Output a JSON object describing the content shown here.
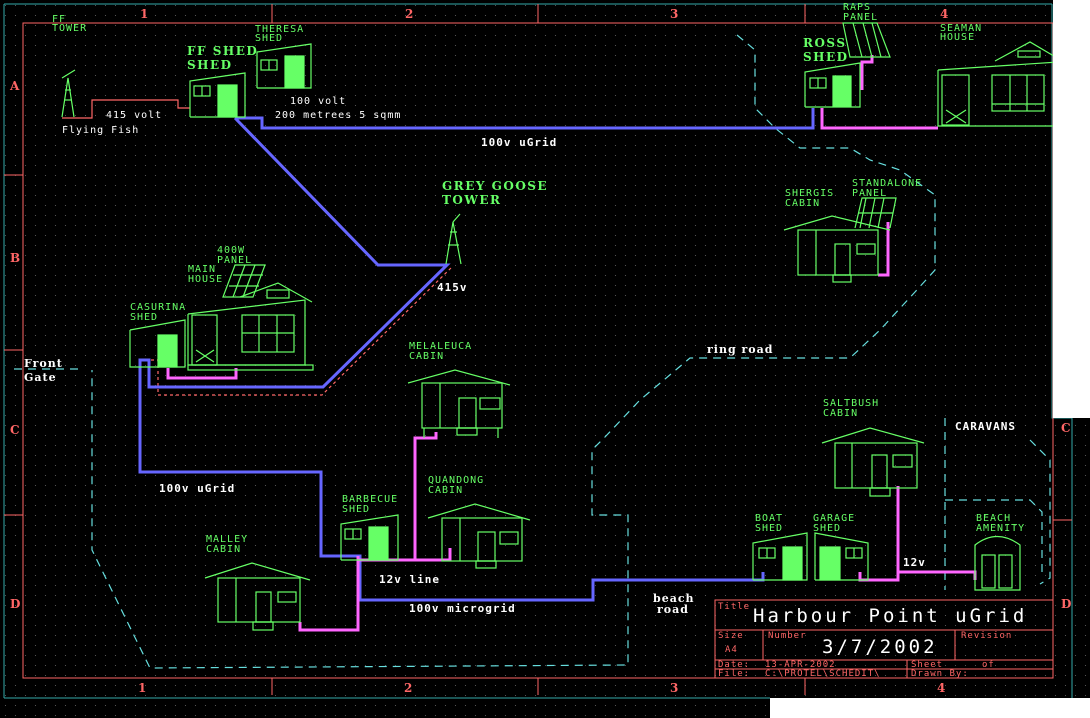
{
  "colors": {
    "background": "#000000",
    "border": "#ff6666",
    "outer_border": "#33aaaa",
    "building": "#66ff66",
    "ugrid_100v": "#6666ff",
    "line_12v": "#ff66ff",
    "line_415v": "#ff6666",
    "road": "#66dddd",
    "label_white": "#ffffff"
  },
  "border": {
    "column_labels": [
      "1",
      "2",
      "3",
      "4"
    ],
    "row_labels": [
      "A",
      "B",
      "C",
      "D"
    ]
  },
  "buildings": {
    "ff_tower": {
      "label1": "FF",
      "label2": "TOWER",
      "caption": "Flying Fish"
    },
    "ff_shed": {
      "label1": "FF SHED",
      "label2": "SHED"
    },
    "theresa_shed": {
      "label1": "THERESA",
      "label2": "SHED"
    },
    "ross_shed": {
      "label1": "ROSS",
      "label2": "SHED"
    },
    "raps_panel": {
      "label1": "RAPS",
      "label2": "PANEL"
    },
    "seaman_house": {
      "label1": "SEAMAN",
      "label2": "HOUSE"
    },
    "grey_goose_tower": {
      "label1": "GREY GOOSE",
      "label2": "TOWER"
    },
    "shergis_cabin": {
      "label1": "SHERGIS",
      "label2": "CABIN"
    },
    "standalone_panel": {
      "label1": "STANDALONE",
      "label2": "PANEL"
    },
    "panel_400w": {
      "label1": "400W",
      "label2": "PANEL"
    },
    "main_house": {
      "label1": "MAIN",
      "label2": "HOUSE"
    },
    "casurina_shed": {
      "label1": "CASURINA",
      "label2": "SHED"
    },
    "melaleuca_cabin": {
      "label1": "MELALEUCA",
      "label2": "CABIN"
    },
    "saltbush_cabin": {
      "label1": "SALTBUSH",
      "label2": "CABIN"
    },
    "quandong_cabin": {
      "label1": "QUANDONG",
      "label2": "CABIN"
    },
    "barbecue_shed": {
      "label1": "BARBECUE",
      "label2": "SHED"
    },
    "malley_cabin": {
      "label1": "MALLEY",
      "label2": "CABIN"
    },
    "boat_shed": {
      "label1": "BOAT",
      "label2": "SHED"
    },
    "garage_shed": {
      "label1": "GARAGE",
      "label2": "SHED"
    },
    "beach_amenity": {
      "label1": "BEACH",
      "label2": "AMENITY"
    },
    "caravans": {
      "label": "CARAVANS"
    }
  },
  "annotations": {
    "volt_415_top": "415 volt",
    "volt_100": "100 volt",
    "cable_spec": "200 metrees 5 sqmm",
    "ugrid_top": "100v uGrid",
    "volt_415_tower": "415v",
    "ugrid_left": "100v uGrid",
    "line_12v": "12v line",
    "microgrid": "100v microgrid",
    "v12_right": "12v",
    "ring_road": "ring road",
    "beach_road_1": "beach",
    "beach_road_2": "road",
    "front_gate_1": "Front",
    "front_gate_2": "Gate"
  },
  "title_block": {
    "title_label": "Title",
    "title": "Harbour Point uGrid",
    "size_label": "Size",
    "size": "A4",
    "number_label": "Number",
    "number": "3/7/2002",
    "revision_label": "Revision",
    "date_label": "Date:",
    "date": "13-APR-2002",
    "sheet_label": "Sheet",
    "sheet_of": "of",
    "file_label": "File:",
    "file": "C:\\PROTEL\\SCHEDIT\\",
    "drawn_by_label": "Drawn By:"
  }
}
